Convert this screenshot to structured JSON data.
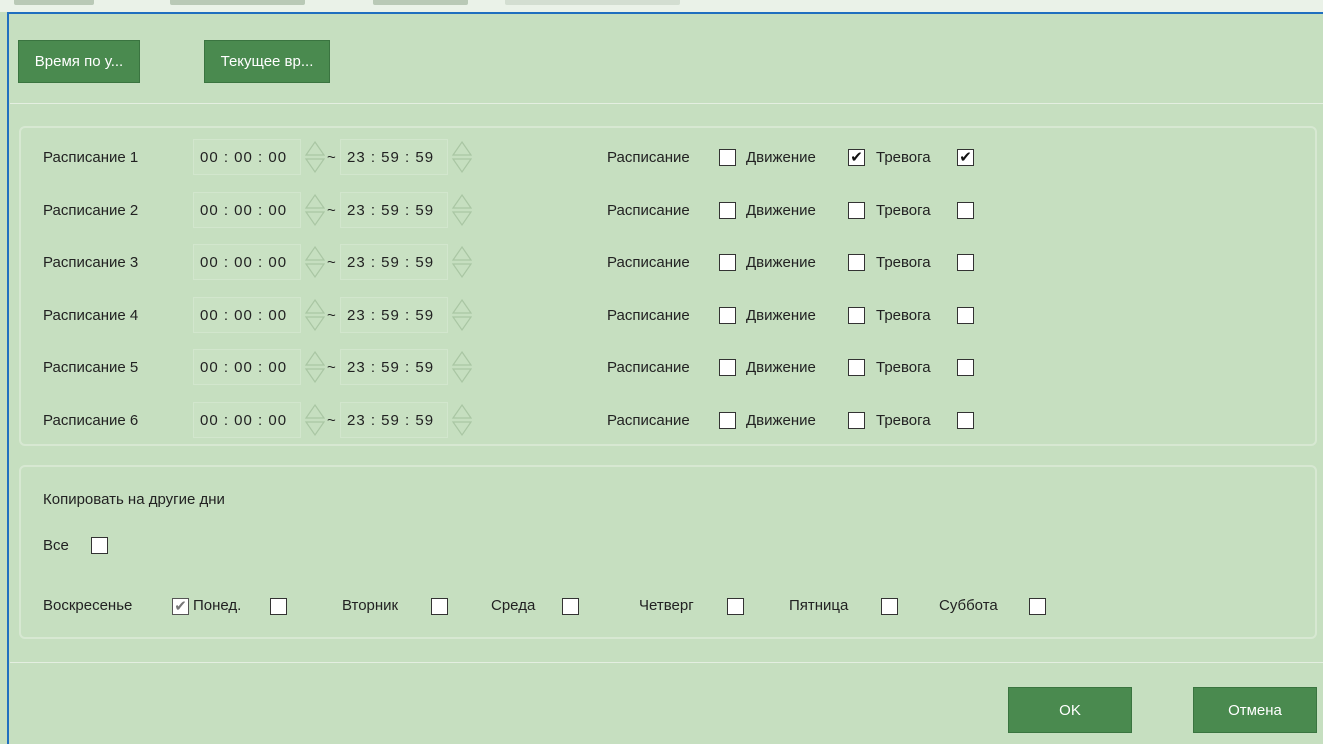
{
  "toolbar": {
    "sync_button": "Время по у...",
    "current_time_button": "Текущее вр..."
  },
  "schedules": [
    {
      "label": "Расписание 1",
      "start": "00 : 00 : 00",
      "end": "23 : 59 : 59",
      "schedule": false,
      "motion": true,
      "alarm": true
    },
    {
      "label": "Расписание 2",
      "start": "00 : 00 : 00",
      "end": "23 : 59 : 59",
      "schedule": false,
      "motion": false,
      "alarm": false
    },
    {
      "label": "Расписание 3",
      "start": "00 : 00 : 00",
      "end": "23 : 59 : 59",
      "schedule": false,
      "motion": false,
      "alarm": false
    },
    {
      "label": "Расписание 4",
      "start": "00 : 00 : 00",
      "end": "23 : 59 : 59",
      "schedule": false,
      "motion": false,
      "alarm": false
    },
    {
      "label": "Расписание 5",
      "start": "00 : 00 : 00",
      "end": "23 : 59 : 59",
      "schedule": false,
      "motion": false,
      "alarm": false
    },
    {
      "label": "Расписание 6",
      "start": "00 : 00 : 00",
      "end": "23 : 59 : 59",
      "schedule": false,
      "motion": false,
      "alarm": false
    }
  ],
  "type_labels": {
    "schedule": "Расписание",
    "motion": "Движение",
    "alarm": "Тревога"
  },
  "tilde": "~",
  "copy": {
    "title": "Копировать на другие дни",
    "all_label": "Все",
    "all_checked": false,
    "days": [
      {
        "label": "Воскресенье",
        "checked": true,
        "disabled": true
      },
      {
        "label": "Понед.",
        "checked": false
      },
      {
        "label": "Вторник",
        "checked": false
      },
      {
        "label": "Среда",
        "checked": false
      },
      {
        "label": "Четверг",
        "checked": false
      },
      {
        "label": "Пятница",
        "checked": false
      },
      {
        "label": "Суббота",
        "checked": false
      }
    ]
  },
  "footer": {
    "ok": "OK",
    "cancel": "Отмена"
  },
  "colors": {
    "background": "#c6dfc0",
    "button": "#4a8a4f",
    "accent_border": "#1f6fbf"
  }
}
